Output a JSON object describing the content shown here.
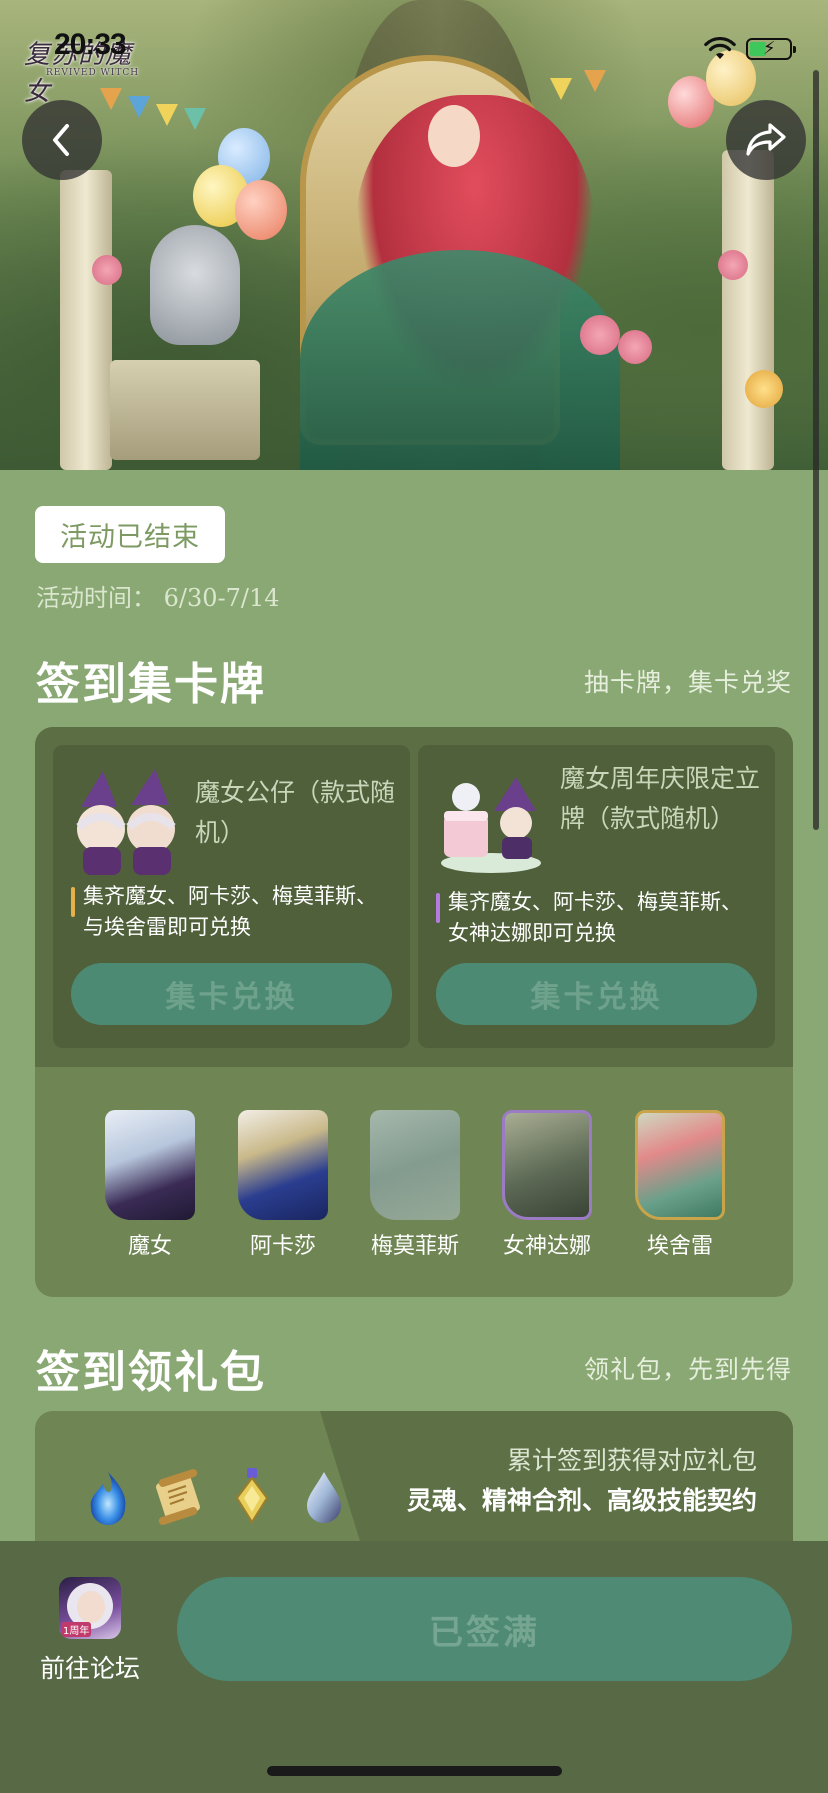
{
  "status_bar": {
    "time": "20:33"
  },
  "banner": {
    "logo": "复苏的魔女",
    "logo_sub": "REVIVED WITCH"
  },
  "event": {
    "status": "活动已结束",
    "time_label": "活动时间：",
    "time_range": "6/30-7/14"
  },
  "card_section": {
    "title": "签到集卡牌",
    "subtitle": "抽卡牌，集卡兑奖",
    "prizes": [
      {
        "name": "魔女公仔（款式随机）",
        "desc": "集齐魔女、阿卡莎、梅莫菲斯、与埃舍雷即可兑换",
        "button": "集卡兑换",
        "accent": "#e8b04a"
      },
      {
        "name": "魔女周年庆限定立牌（款式随机）",
        "desc": "集齐魔女、阿卡莎、梅莫菲斯、女神达娜即可兑换",
        "button": "集卡兑换",
        "accent": "#b57be0"
      }
    ],
    "characters": [
      {
        "name": "魔女"
      },
      {
        "name": "阿卡莎"
      },
      {
        "name": "梅莫菲斯"
      },
      {
        "name": "女神达娜"
      },
      {
        "name": "埃舍雷"
      }
    ]
  },
  "gift_section": {
    "title": "签到领礼包",
    "subtitle": "领礼包，先到先得",
    "line1": "累计签到获得对应礼包",
    "line2": "灵魂、精神合剂、高级技能契约",
    "icons": [
      "soul-flame-icon",
      "scroll-icon",
      "potion-icon",
      "crystal-drop-icon"
    ]
  },
  "bottom_bar": {
    "forum_label": "前往论坛",
    "forum_badge": "1周年",
    "signin_button": "已签满"
  }
}
